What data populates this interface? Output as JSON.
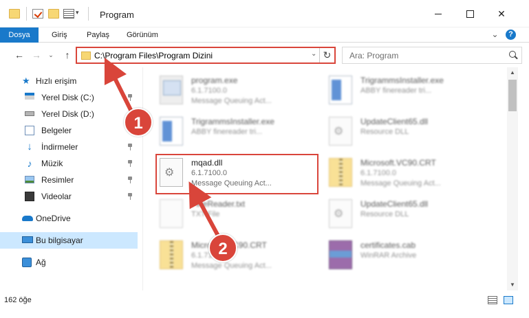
{
  "window": {
    "title": "Program",
    "close_glyph": "✕"
  },
  "ribbon": {
    "tabs": [
      "Dosya",
      "Giriş",
      "Paylaş",
      "Görünüm"
    ],
    "expand_glyph": "⌄",
    "help_glyph": "?"
  },
  "address": {
    "path": "C:\\Program Files\\Program Dizini",
    "back_glyph": "←",
    "forward_glyph": "→",
    "recent_glyph": "⌄",
    "up_glyph": "↑",
    "dropdown_glyph": "⌄",
    "refresh_glyph": "↻"
  },
  "search": {
    "placeholder": "Ara: Program"
  },
  "sidebar": {
    "items": [
      {
        "label": "Hızlı erişim",
        "icon": "star-icon"
      },
      {
        "label": "Yerel Disk (C:)",
        "icon": "drive-icon"
      },
      {
        "label": "Yerel Disk (D:)",
        "icon": "drive-icon"
      },
      {
        "label": "Belgeler",
        "icon": "documents-icon"
      },
      {
        "label": "İndirmeler",
        "icon": "download-icon"
      },
      {
        "label": "Müzik",
        "icon": "music-icon"
      },
      {
        "label": "Resimler",
        "icon": "pictures-icon"
      },
      {
        "label": "Videolar",
        "icon": "videos-icon"
      },
      {
        "label": "OneDrive",
        "icon": "cloud-icon"
      },
      {
        "label": "Bu bilgisayar",
        "icon": "computer-icon"
      },
      {
        "label": "Ağ",
        "icon": "network-icon"
      }
    ]
  },
  "files": [
    {
      "name": "program.exe",
      "line1": "6.1.7100.0",
      "line2": "Message Queuing Act...",
      "icon": "exe-icon"
    },
    {
      "name": "TrigrammsInstaller.exe",
      "line1": "ABBY finereader tri...",
      "line2": "",
      "icon": "installer-icon"
    },
    {
      "name": "TrigrammsInstaller.exe",
      "line1": "ABBY finereader tri...",
      "line2": "",
      "icon": "installer-icon"
    },
    {
      "name": "UpdateClient65.dll",
      "line1": "Resource DLL",
      "line2": "",
      "icon": "dll-icon"
    },
    {
      "name": "mqad.dll",
      "line1": "6.1.7100.0",
      "line2": "Message Queuing Act...",
      "icon": "dll-icon"
    },
    {
      "name": "Microsoft.VC90.CRT",
      "line1": "6.1.7100.0",
      "line2": "Message Queuing Act...",
      "icon": "zip-folder-icon"
    },
    {
      "name": "FineReader.txt",
      "line1": "TXT File",
      "line2": "",
      "icon": "text-file-icon"
    },
    {
      "name": "UpdateClient65.dll",
      "line1": "Resource DLL",
      "line2": "",
      "icon": "dll-icon"
    },
    {
      "name": "Microsoft.VC90.CRT",
      "line1": "6.1.7100.0",
      "line2": "Message Queuing Act...",
      "icon": "zip-folder-icon"
    },
    {
      "name": "certificates.cab",
      "line1": "WinRAR Archive",
      "line2": "",
      "icon": "rar-archive-icon"
    }
  ],
  "status": {
    "count": "162 öğe"
  },
  "annotations": {
    "badge1": "1",
    "badge2": "2",
    "accent": "#d9453a"
  }
}
